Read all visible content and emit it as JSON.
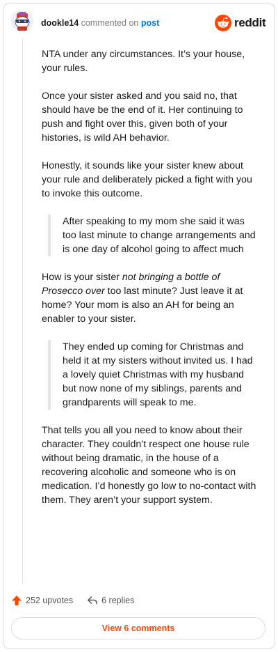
{
  "header": {
    "username": "dookle14",
    "action_text": "commented on",
    "target_text": "post",
    "brand_wordmark": "reddit",
    "brand_color": "#ff4500",
    "avatar_icon": "snoo-avatar-icon"
  },
  "comment": {
    "paragraphs": [
      "NTA under any circumstances. It’s your house, your rules.",
      "Once your sister asked and you said no, that should have be the end of it. Her continuing to push and fight over this, given both of your histories, is wild AH behavior.",
      "Honestly, it sounds like your sister knew about your rule and deliberately picked a fight with you to invoke this outcome."
    ],
    "quote1": "After speaking to my mom she said it was too last minute to change arrangements and is one day of alcohol going to affect much",
    "p4_before": "How is your sister ",
    "p4_italic": "not bringing a bottle of Prosecco over",
    "p4_after": " too last minute? Just leave it at home? Your mom is also an AH for being an enabler to your sister.",
    "quote2": "They ended up coming for Christmas and held it at my sisters without invited us. I had a lovely quiet Christmas with my husband but now none of my siblings, parents and grandparents will speak to me.",
    "p5": "That tells you all you need to know about their character. They couldn’t respect one house rule without being dramatic, in the house of a recovering alcoholic and someone who is on medication. I’d honestly go low to no-contact with them. They aren’t your support system."
  },
  "footer": {
    "upvotes_label": "252 upvotes",
    "replies_label": "6 replies",
    "view_comments_label": "View 6 comments",
    "upvote_icon": "upvote-arrow-icon",
    "reply_icon": "reply-arrow-icon"
  }
}
